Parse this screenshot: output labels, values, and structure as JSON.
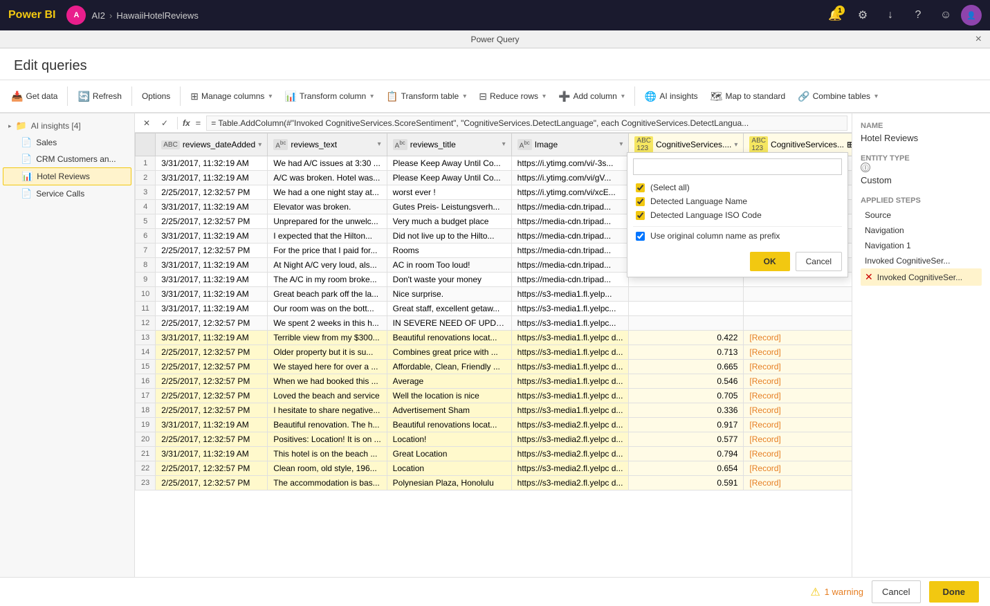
{
  "app": {
    "brand": "Power BI",
    "pq_title": "Power Query",
    "close_label": "×",
    "edit_queries_title": "Edit queries"
  },
  "topnav": {
    "user_initials": "A",
    "user_label": "AI2",
    "breadcrumb": [
      "AI2",
      ">",
      "HawaiiHotelReviews"
    ],
    "notification_count": "1",
    "icons": [
      "bell",
      "gear",
      "download",
      "help",
      "smiley",
      "user"
    ]
  },
  "toolbar": {
    "get_data": "Get data",
    "refresh": "Refresh",
    "options": "Options",
    "manage_columns": "Manage columns",
    "transform_column": "Transform column",
    "transform_table": "Transform table",
    "reduce_rows": "Reduce rows",
    "add_column": "Add column",
    "ai_insights": "AI insights",
    "map_to_standard": "Map to standard",
    "combine_tables": "Combine tables"
  },
  "sidebar": {
    "ai_insights_label": "AI insights [4]",
    "items": [
      {
        "name": "Sales",
        "icon": "table"
      },
      {
        "name": "CRM Customers an...",
        "icon": "table"
      },
      {
        "name": "Hotel Reviews",
        "icon": "table",
        "active": true
      },
      {
        "name": "Service Calls",
        "icon": "table"
      }
    ]
  },
  "formula_bar": {
    "content": "= Table.AddColumn(#\"Invoked CognitiveServices.ScoreSentiment\", \"CognitiveServices.DetectLanguage\", each CognitiveServices.DetectLangua..."
  },
  "columns": [
    {
      "name": "reviews_dateAdded",
      "type": "ABC"
    },
    {
      "name": "reviews_text",
      "type": "ABC"
    },
    {
      "name": "reviews_title",
      "type": "ABC"
    },
    {
      "name": "Image",
      "type": "ABC"
    },
    {
      "name": "CognitiveServices....",
      "type": "123"
    },
    {
      "name": "CognitiveServices...",
      "type": "123"
    }
  ],
  "rows": [
    {
      "num": 1,
      "date": "3/31/2017, 11:32:19 AM",
      "text": "We had A/C issues at 3:30 ...",
      "title": "Please Keep Away Until Co...",
      "image": "https://i.ytimg.com/vi/-3s...",
      "cog1": "",
      "cog2": ""
    },
    {
      "num": 2,
      "date": "3/31/2017, 11:32:19 AM",
      "text": "A/C was broken. Hotel was...",
      "title": "Please Keep Away Until Co...",
      "image": "https://i.ytimg.com/vi/gV...",
      "cog1": "",
      "cog2": ""
    },
    {
      "num": 3,
      "date": "2/25/2017, 12:32:57 PM",
      "text": "We had a one night stay at...",
      "title": "worst ever !",
      "image": "https://i.ytimg.com/vi/xcE...",
      "cog1": "",
      "cog2": ""
    },
    {
      "num": 4,
      "date": "3/31/2017, 11:32:19 AM",
      "text": "Elevator was broken.",
      "title": "Gutes Preis- Leistungsverh...",
      "image": "https://media-cdn.tripad...",
      "cog1": "",
      "cog2": ""
    },
    {
      "num": 5,
      "date": "2/25/2017, 12:32:57 PM",
      "text": "Unprepared for the unwelc...",
      "title": "Very much a budget place",
      "image": "https://media-cdn.tripad...",
      "cog1": "",
      "cog2": ""
    },
    {
      "num": 6,
      "date": "3/31/2017, 11:32:19 AM",
      "text": "I expected that the Hilton...",
      "title": "Did not live up to the Hilto...",
      "image": "https://media-cdn.tripad...",
      "cog1": "",
      "cog2": ""
    },
    {
      "num": 7,
      "date": "2/25/2017, 12:32:57 PM",
      "text": "For the price that I paid for...",
      "title": "Rooms",
      "image": "https://media-cdn.tripad...",
      "cog1": "",
      "cog2": ""
    },
    {
      "num": 8,
      "date": "3/31/2017, 11:32:19 AM",
      "text": "At Night A/C very loud, als...",
      "title": "AC in room Too loud!",
      "image": "https://media-cdn.tripad...",
      "cog1": "",
      "cog2": ""
    },
    {
      "num": 9,
      "date": "3/31/2017, 11:32:19 AM",
      "text": "The A/C in my room broke...",
      "title": "Don't waste your money",
      "image": "https://media-cdn.tripad...",
      "cog1": "",
      "cog2": ""
    },
    {
      "num": 10,
      "date": "3/31/2017, 11:32:19 AM",
      "text": "Great beach park off the la...",
      "title": "Nice surprise.",
      "image": "https://s3-media1.fl.yelp...",
      "cog1": "",
      "cog2": ""
    },
    {
      "num": 11,
      "date": "3/31/2017, 11:32:19 AM",
      "text": "Our room was on the bott...",
      "title": "Great staff, excellent getaw...",
      "image": "https://s3-media1.fl.yelpc...",
      "cog1": "",
      "cog2": ""
    },
    {
      "num": 12,
      "date": "2/25/2017, 12:32:57 PM",
      "text": "We spent 2 weeks in this h...",
      "title": "IN SEVERE NEED OF UPDA...",
      "image": "https://s3-media1.fl.yelpc...",
      "cog1": "",
      "cog2": ""
    },
    {
      "num": 13,
      "date": "3/31/2017, 11:32:19 AM",
      "text": "Terrible view from my $300...",
      "title": "Beautiful renovations locat...",
      "image": "https://s3-media1.fl.yelpc d...",
      "cog1": "0.422",
      "cog2": "[Record]",
      "highlight": true
    },
    {
      "num": 14,
      "date": "2/25/2017, 12:32:57 PM",
      "text": "Older property but it is su...",
      "title": "Combines great price with ...",
      "image": "https://s3-media1.fl.yelpc d...",
      "cog1": "0.713",
      "cog2": "[Record]",
      "highlight": true
    },
    {
      "num": 15,
      "date": "2/25/2017, 12:32:57 PM",
      "text": "We stayed here for over a ...",
      "title": "Affordable, Clean, Friendly ...",
      "image": "https://s3-media1.fl.yelpc d...",
      "cog1": "0.665",
      "cog2": "[Record]",
      "highlight": true
    },
    {
      "num": 16,
      "date": "2/25/2017, 12:32:57 PM",
      "text": "When we had booked this ...",
      "title": "Average",
      "image": "https://s3-media1.fl.yelpc d...",
      "cog1": "0.546",
      "cog2": "[Record]",
      "highlight": true
    },
    {
      "num": 17,
      "date": "2/25/2017, 12:32:57 PM",
      "text": "Loved the beach and service",
      "title": "Well the location is nice",
      "image": "https://s3-media1.fl.yelpc d...",
      "cog1": "0.705",
      "cog2": "[Record]",
      "highlight": true
    },
    {
      "num": 18,
      "date": "2/25/2017, 12:32:57 PM",
      "text": "I hesitate to share negative...",
      "title": "Advertisement Sham",
      "image": "https://s3-media1.fl.yelpc d...",
      "cog1": "0.336",
      "cog2": "[Record]",
      "highlight": true
    },
    {
      "num": 19,
      "date": "3/31/2017, 11:32:19 AM",
      "text": "Beautiful renovation. The h...",
      "title": "Beautiful renovations locat...",
      "image": "https://s3-media2.fl.yelpc d...",
      "cog1": "0.917",
      "cog2": "[Record]",
      "highlight": true
    },
    {
      "num": 20,
      "date": "2/25/2017, 12:32:57 PM",
      "text": "Positives: Location! It is on ...",
      "title": "Location!",
      "image": "https://s3-media2.fl.yelpc d...",
      "cog1": "0.577",
      "cog2": "[Record]",
      "highlight": true
    },
    {
      "num": 21,
      "date": "3/31/2017, 11:32:19 AM",
      "text": "This hotel is on the beach ...",
      "title": "Great Location",
      "image": "https://s3-media2.fl.yelpc d...",
      "cog1": "0.794",
      "cog2": "[Record]",
      "highlight": true
    },
    {
      "num": 22,
      "date": "2/25/2017, 12:32:57 PM",
      "text": "Clean room, old style, 196...",
      "title": "Location",
      "image": "https://s3-media2.fl.yelpc d...",
      "cog1": "0.654",
      "cog2": "[Record]",
      "highlight": true
    },
    {
      "num": 23,
      "date": "2/25/2017, 12:32:57 PM",
      "text": "The accommodation is bas...",
      "title": "Polynesian Plaza, Honolulu",
      "image": "https://s3-media2.fl.yelpc d...",
      "cog1": "0.591",
      "cog2": "[Record]",
      "highlight": true
    }
  ],
  "dropdown": {
    "search_placeholder": "",
    "options": [
      {
        "label": "(Select all)",
        "checked": true
      },
      {
        "label": "Detected Language Name",
        "checked": true
      },
      {
        "label": "Detected Language ISO Code",
        "checked": true
      }
    ],
    "use_prefix_label": "Use original column name as prefix",
    "use_prefix_checked": true,
    "ok_label": "OK",
    "cancel_label": "Cancel"
  },
  "right_panel": {
    "name_label": "Name",
    "name_value": "Hotel Reviews",
    "entity_type_label": "Entity type",
    "entity_type_value": "Custom",
    "applied_steps_label": "Applied steps",
    "steps": [
      {
        "name": "Source",
        "active": false,
        "delete": false
      },
      {
        "name": "Navigation",
        "active": false,
        "delete": false
      },
      {
        "name": "Navigation 1",
        "active": false,
        "delete": false
      },
      {
        "name": "Invoked CognitiveSer...",
        "active": false,
        "delete": false
      },
      {
        "name": "Invoked CognitiveSer...",
        "active": true,
        "delete": true
      }
    ]
  },
  "bottom_bar": {
    "warning_count": "1 warning",
    "cancel_label": "Cancel",
    "done_label": "Done"
  }
}
